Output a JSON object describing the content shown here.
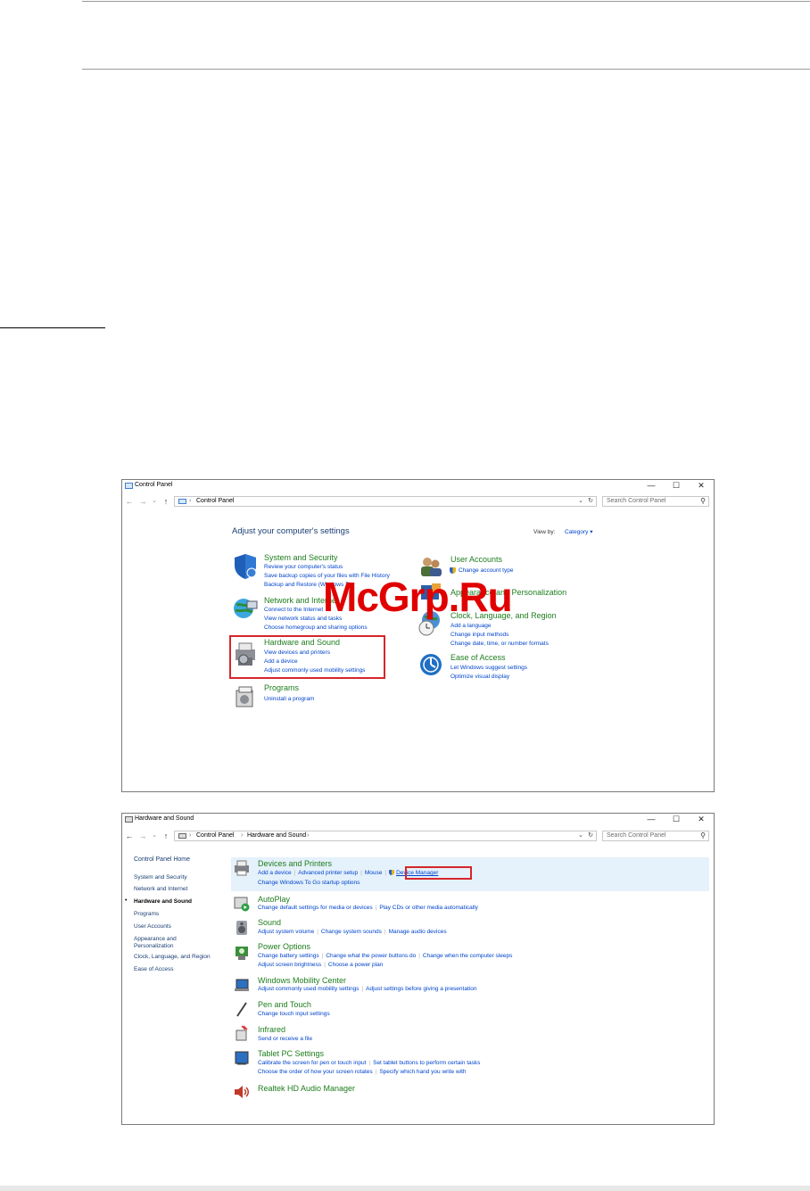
{
  "window1": {
    "title": "Control Panel",
    "breadcrumb": "Control Panel",
    "search_placeholder": "Search Control Panel",
    "heading": "Adjust your computer's settings",
    "view_by_label": "View by:",
    "view_by_value": "Category",
    "categories": [
      {
        "title": "System and Security",
        "links": [
          "Review your computer's status",
          "Save backup copies of your files with File History",
          "Backup and Restore (Windows 7)"
        ]
      },
      {
        "title": "Network and Internet",
        "links": [
          "Connect to the Internet",
          "View network status and tasks",
          "Choose homegroup and sharing options"
        ]
      },
      {
        "title": "Hardware and Sound",
        "links": [
          "View devices and printers",
          "Add a device",
          "Adjust commonly used mobility settings"
        ]
      },
      {
        "title": "Programs",
        "links": [
          "Uninstall a program"
        ]
      },
      {
        "title": "User Accounts",
        "links": [
          "Change account type"
        ]
      },
      {
        "title": "Appearance and Personalization",
        "links": []
      },
      {
        "title": "Clock, Language, and Region",
        "links": [
          "Add a language",
          "Change input methods",
          "Change date, time, or number formats"
        ]
      },
      {
        "title": "Ease of Access",
        "links": [
          "Let Windows suggest settings",
          "Optimize visual display"
        ]
      }
    ]
  },
  "window2": {
    "title": "Hardware and Sound",
    "breadcrumb": [
      "Control Panel",
      "Hardware and Sound"
    ],
    "search_placeholder": "Search Control Panel",
    "sidebar": [
      "Control Panel Home",
      "System and Security",
      "Network and Internet",
      "Hardware and Sound",
      "Programs",
      "User Accounts",
      "Appearance and Personalization",
      "Clock, Language, and Region",
      "Ease of Access"
    ],
    "sections": [
      {
        "title": "Devices and Printers",
        "rows": [
          [
            "Add a device",
            "Advanced printer setup",
            "Mouse",
            "Device Manager"
          ],
          [
            "Change Windows To Go startup options"
          ]
        ]
      },
      {
        "title": "AutoPlay",
        "rows": [
          [
            "Change default settings for media or devices",
            "Play CDs or other media automatically"
          ]
        ]
      },
      {
        "title": "Sound",
        "rows": [
          [
            "Adjust system volume",
            "Change system sounds",
            "Manage audio devices"
          ]
        ]
      },
      {
        "title": "Power Options",
        "rows": [
          [
            "Change battery settings",
            "Change what the power buttons do",
            "Change when the computer sleeps"
          ],
          [
            "Adjust screen brightness",
            "Choose a power plan"
          ]
        ]
      },
      {
        "title": "Windows Mobility Center",
        "rows": [
          [
            "Adjust commonly used mobility settings",
            "Adjust settings before giving a presentation"
          ]
        ]
      },
      {
        "title": "Pen and Touch",
        "rows": [
          [
            "Change touch input settings"
          ]
        ]
      },
      {
        "title": "Infrared",
        "rows": [
          [
            "Send or receive a file"
          ]
        ]
      },
      {
        "title": "Tablet PC Settings",
        "rows": [
          [
            "Calibrate the screen for pen or touch input",
            "Set tablet buttons to perform certain tasks"
          ],
          [
            "Choose the order of how your screen rotates",
            "Specify which hand you write with"
          ]
        ]
      },
      {
        "title": "Realtek HD Audio Manager",
        "rows": []
      }
    ]
  },
  "watermark": "McGrp.Ru",
  "controls": {
    "minimize": "—",
    "maximize": "☐",
    "close": "✕",
    "back": "←",
    "forward": "→",
    "recent": "⌄",
    "up": "↑",
    "refresh": "↻",
    "search": "⚲",
    "dropdown": "⌄"
  },
  "colors": {
    "link": "#0044cc",
    "category": "#1e7d1e",
    "highlight": "#d6262a"
  }
}
